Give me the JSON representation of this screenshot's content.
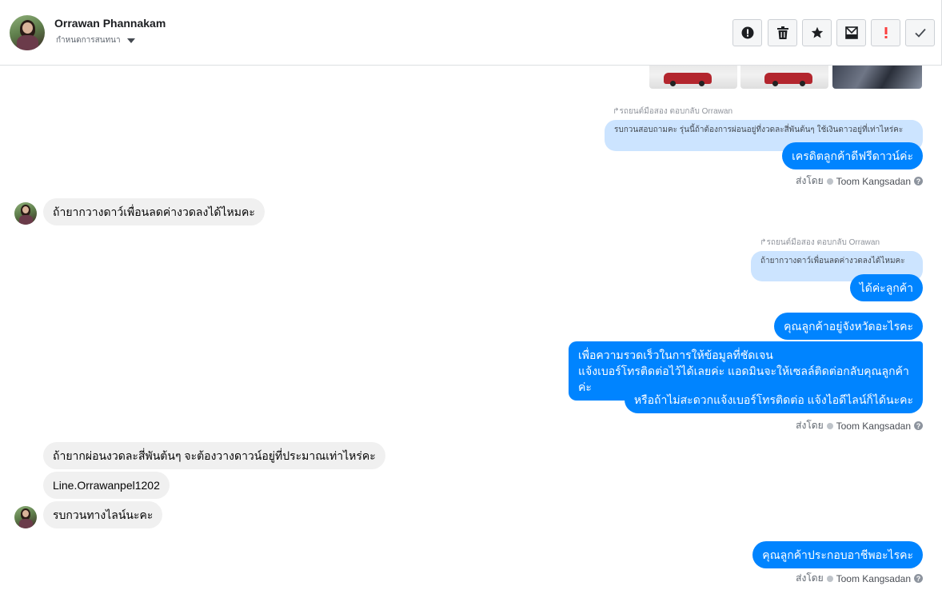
{
  "header": {
    "contact_name": "Orrawan Phannakam",
    "contact_status": "กำหนดการสนทนา",
    "actions": [
      {
        "icon": "alert-circle-icon",
        "color": "#1c1e21"
      },
      {
        "icon": "trash-icon",
        "color": "#1c1e21"
      },
      {
        "icon": "star-icon",
        "color": "#1c1e21"
      },
      {
        "icon": "mark-unread-icon",
        "color": "#1c1e21"
      },
      {
        "icon": "important-icon",
        "color": "#fa3e3e"
      },
      {
        "icon": "check-icon",
        "color": "#444950"
      }
    ]
  },
  "messages": {
    "reply1_label": "รถยนต์มือสอง ตอบกลับ Orrawan",
    "reply1_quote": "รบกวนสอบถามคะ รุ่นนี้ถ้าต้องการผ่อนอยู่ที่งวดละสี่พันต้นๆ ใช้เงินดาวอยู่ที่เท่าไหร่คะ",
    "out1": "เครดิตลูกค้าดีฟรีดาวน์ค่ะ",
    "sent_by_label": "ส่งโดย",
    "sent_by_name": "Toom Kangsadan",
    "in1": "ถ้ายากวางดาว์เพื่อนลดค่างวดลงได้ไหมคะ",
    "reply2_label": "รถยนต์มือสอง ตอบกลับ Orrawan",
    "reply2_quote": "ถ้ายากวางดาว์เพื่อนลดค่างวดลงได้ไหมคะ",
    "out2": "ได้ค่ะลูกค้า",
    "out3": "คุณลูกค้าอยู่จังหวัดอะไรคะ",
    "out4_line1": "เพื่อความรวดเร็วในการให้ข้อมูลที่ชัดเจน",
    "out4_line2": "แจ้งเบอร์โทรติดต่อไว้ได้เลยค่ะ แอดมินจะให้เซลล์ติดต่อกลับคุณลูกค้าค่ะ",
    "out5": "หรือถ้าไม่สะดวกแจ้งเบอร์โทรติดต่อ แจ้งไอดีไลน์ก็ได้นะคะ",
    "in2": "ถ้ายากผ่อนงวดละสี่พันต้นๆ จะต้องวางดาวน์อยู่ที่ประมาณเท่าไหร่คะ",
    "in3": "Line.Orrawanpel1202",
    "in4": "รบกวนทางไลน์นะคะ",
    "out6": "คุณลูกค้าประกอบอาชีพอะไรคะ"
  }
}
